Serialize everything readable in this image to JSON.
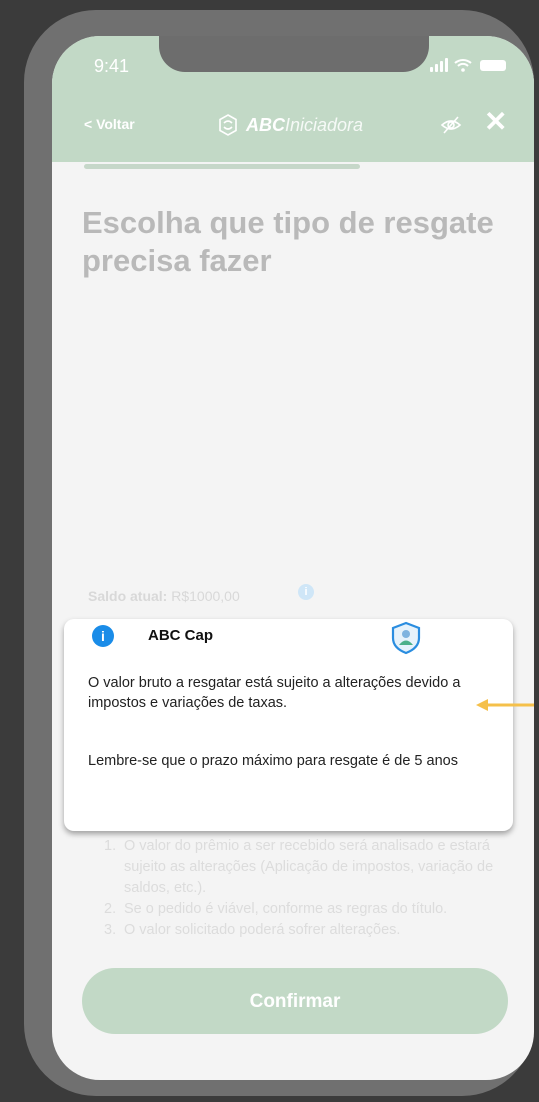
{
  "status_bar": {
    "time": "9:41"
  },
  "header": {
    "back_label": "< Voltar",
    "brand_bold": "ABC",
    "brand_light": "Iniciadora",
    "eye_icon": "eye-off-icon",
    "close_label": "✕"
  },
  "main": {
    "title": "Escolha que tipo de resgate precisa fazer",
    "balance_label": "Saldo atual:",
    "balance_value": "R$1000,00",
    "steps": [
      {
        "num": "1.",
        "text": "O valor do prêmio a ser recebido será analisado e estará sujeito as alterações (Aplicação de impostos, variação de saldos, etc.)."
      },
      {
        "num": "2.",
        "text": "Se o pedido é viável, conforme as regras do título."
      },
      {
        "num": "3.",
        "text": "O valor solicitado poderá sofrer alterações."
      }
    ],
    "confirm_label": "Confirmar"
  },
  "card": {
    "title": "ABC Cap",
    "text1": "O valor bruto a resgatar está sujeito a alterações devido a impostos e variações de taxas.",
    "text2": "Lembre-se que o prazo máximo para resgate é de 5 anos"
  },
  "colors": {
    "accent": "#c2d9c6",
    "info_blue": "#1a8ce8",
    "annotation_arrow": "#f5c04a"
  }
}
